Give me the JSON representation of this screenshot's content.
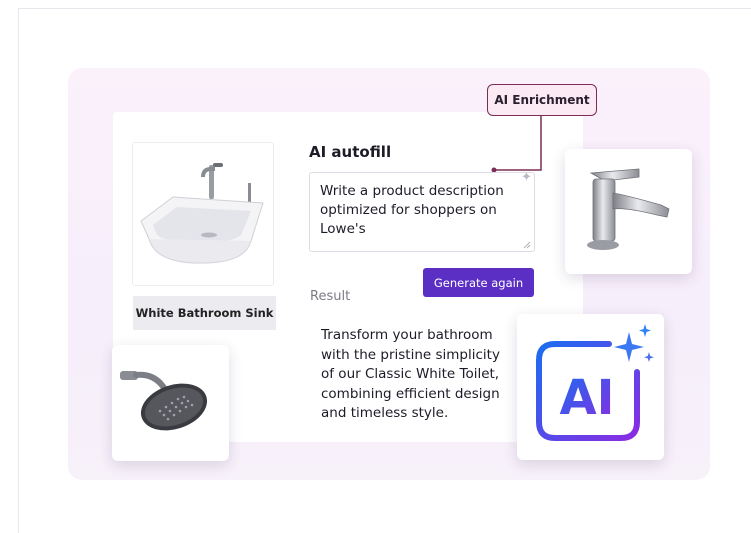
{
  "enrichment_tag": {
    "label": "AI Enrichment"
  },
  "autofill": {
    "title": "AI autofill",
    "prompt_value": "Write a product description optimized for shoppers on Lowe's",
    "generate_label": "Generate again",
    "result_label": "Result",
    "result_text": "Transform your bathroom with the pristine simplicity of our Classic White Toilet, combining efficient design and timeless style."
  },
  "product": {
    "label": "White Bathroom Sink",
    "image_icon": "bathroom-sink-icon"
  },
  "side_images": {
    "faucet_icon": "faucet-icon",
    "shower_icon": "shower-head-icon",
    "ai_badge_icon": "ai-badge-icon",
    "ai_badge_text": "AI"
  },
  "colors": {
    "accent_purple": "#5b2fc4",
    "tag_border": "#7a2d55",
    "tag_fill": "#fbeaf3",
    "ai_gradient_start": "#1b6df0",
    "ai_gradient_end": "#8a2be2"
  }
}
